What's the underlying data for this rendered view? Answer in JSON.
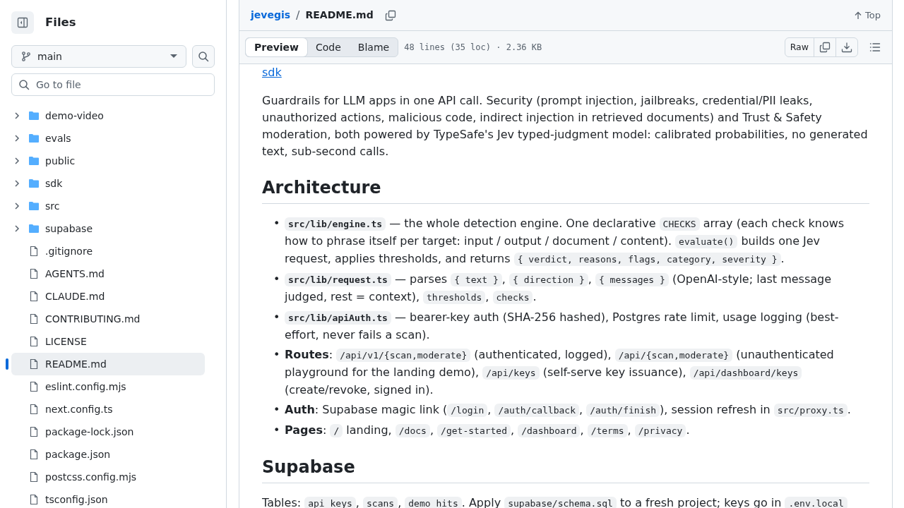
{
  "sidebar": {
    "title": "Files",
    "branch": "main",
    "search": {
      "placeholder": "Go to file"
    },
    "tree": [
      {
        "name": "demo-video",
        "kind": "folder",
        "expanded": false,
        "selected": false
      },
      {
        "name": "evals",
        "kind": "folder",
        "expanded": false,
        "selected": false
      },
      {
        "name": "public",
        "kind": "folder",
        "expanded": false,
        "selected": false
      },
      {
        "name": "sdk",
        "kind": "folder",
        "expanded": false,
        "selected": false
      },
      {
        "name": "src",
        "kind": "folder",
        "expanded": false,
        "selected": false
      },
      {
        "name": "supabase",
        "kind": "folder",
        "expanded": false,
        "selected": false
      },
      {
        "name": ".gitignore",
        "kind": "file",
        "selected": false
      },
      {
        "name": "AGENTS.md",
        "kind": "file",
        "selected": false
      },
      {
        "name": "CLAUDE.md",
        "kind": "file",
        "selected": false
      },
      {
        "name": "CONTRIBUTING.md",
        "kind": "file",
        "selected": false
      },
      {
        "name": "LICENSE",
        "kind": "file",
        "selected": false
      },
      {
        "name": "README.md",
        "kind": "file",
        "selected": true
      },
      {
        "name": "eslint.config.mjs",
        "kind": "file",
        "selected": false
      },
      {
        "name": "next.config.ts",
        "kind": "file",
        "selected": false
      },
      {
        "name": "package-lock.json",
        "kind": "file",
        "selected": false
      },
      {
        "name": "package.json",
        "kind": "file",
        "selected": false
      },
      {
        "name": "postcss.config.mjs",
        "kind": "file",
        "selected": false
      },
      {
        "name": "tsconfig.json",
        "kind": "file",
        "selected": false
      }
    ]
  },
  "breadcrumb": {
    "repo": "jevegis",
    "separator": "/",
    "file": "README.md"
  },
  "top_link": "Top",
  "tabs": [
    {
      "label": "Preview",
      "selected": true
    },
    {
      "label": "Code",
      "selected": false
    },
    {
      "label": "Blame",
      "selected": false
    }
  ],
  "file_info": "48 lines (35 loc) · 2.36 KB",
  "raw_button": "Raw",
  "content": [
    {
      "kind": "link",
      "text": "sdk"
    },
    {
      "kind": "paragraph",
      "parts": [
        {
          "kind": "text",
          "text": "Guardrails for LLM apps in one API call. Security (prompt injection, jailbreaks, credential/PII leaks, unauthorized actions, malicious code, indirect injection in retrieved documents) and Trust & Safety moderation, both powered by TypeSafe's Jev typed-judgment model: calibrated probabilities, no generated text, sub-second calls."
        }
      ]
    },
    {
      "kind": "heading",
      "text": "Architecture"
    },
    {
      "kind": "list",
      "marker": "•",
      "items": [
        [
          {
            "kind": "bold_code",
            "text": "src/lib/engine.ts"
          },
          {
            "kind": "text",
            "text": " — the whole detection engine. One declarative "
          },
          {
            "kind": "code",
            "text": "CHECKS"
          },
          {
            "kind": "text",
            "text": " array (each check knows how to phrase itself per target: input / output / document / content). "
          },
          {
            "kind": "code",
            "text": "evaluate()"
          },
          {
            "kind": "text",
            "text": " builds one Jev request, applies thresholds, and returns "
          },
          {
            "kind": "code",
            "text": "{ verdict, reasons, flags, category, severity }"
          },
          {
            "kind": "text",
            "text": "."
          }
        ],
        [
          {
            "kind": "bold_code",
            "text": "src/lib/request.ts"
          },
          {
            "kind": "text",
            "text": " — parses "
          },
          {
            "kind": "code",
            "text": "{ text }"
          },
          {
            "kind": "text",
            "text": ", "
          },
          {
            "kind": "code",
            "text": "{ direction }"
          },
          {
            "kind": "text",
            "text": ", "
          },
          {
            "kind": "code",
            "text": "{ messages }"
          },
          {
            "kind": "text",
            "text": " (OpenAI-style; last message judged, rest = context), "
          },
          {
            "kind": "code",
            "text": "thresholds"
          },
          {
            "kind": "text",
            "text": ", "
          },
          {
            "kind": "code",
            "text": "checks"
          },
          {
            "kind": "text",
            "text": "."
          }
        ],
        [
          {
            "kind": "bold_code",
            "text": "src/lib/apiAuth.ts"
          },
          {
            "kind": "text",
            "text": " — bearer-key auth (SHA-256 hashed), Postgres rate limit, usage logging (best-effort, never fails a scan)."
          }
        ],
        [
          {
            "kind": "bold",
            "text": "Routes"
          },
          {
            "kind": "text",
            "text": ": "
          },
          {
            "kind": "code",
            "text": "/api/v1/{scan,moderate}"
          },
          {
            "kind": "text",
            "text": " (authenticated, logged), "
          },
          {
            "kind": "code",
            "text": "/api/{scan,moderate}"
          },
          {
            "kind": "text",
            "text": " (unauthenticated playground for the landing demo), "
          },
          {
            "kind": "code",
            "text": "/api/keys"
          },
          {
            "kind": "text",
            "text": " (self-serve key issuance), "
          },
          {
            "kind": "code",
            "text": "/api/dashboard/keys"
          },
          {
            "kind": "text",
            "text": " (create/revoke, signed in)."
          }
        ],
        [
          {
            "kind": "bold",
            "text": "Auth"
          },
          {
            "kind": "text",
            "text": ": Supabase magic link ("
          },
          {
            "kind": "code",
            "text": "/login"
          },
          {
            "kind": "text",
            "text": ", "
          },
          {
            "kind": "code",
            "text": "/auth/callback"
          },
          {
            "kind": "text",
            "text": ", "
          },
          {
            "kind": "code",
            "text": "/auth/finish"
          },
          {
            "kind": "text",
            "text": "), session refresh in "
          },
          {
            "kind": "code",
            "text": "src/proxy.ts"
          },
          {
            "kind": "text",
            "text": "."
          }
        ],
        [
          {
            "kind": "bold",
            "text": "Pages"
          },
          {
            "kind": "text",
            "text": ": "
          },
          {
            "kind": "code",
            "text": "/"
          },
          {
            "kind": "text",
            "text": " landing, "
          },
          {
            "kind": "code",
            "text": "/docs"
          },
          {
            "kind": "text",
            "text": ", "
          },
          {
            "kind": "code",
            "text": "/get-started"
          },
          {
            "kind": "text",
            "text": ", "
          },
          {
            "kind": "code",
            "text": "/dashboard"
          },
          {
            "kind": "text",
            "text": ", "
          },
          {
            "kind": "code",
            "text": "/terms"
          },
          {
            "kind": "text",
            "text": ", "
          },
          {
            "kind": "code",
            "text": "/privacy"
          },
          {
            "kind": "text",
            "text": "."
          }
        ]
      ]
    },
    {
      "kind": "heading",
      "text": "Supabase"
    },
    {
      "kind": "paragraph",
      "parts": [
        {
          "kind": "text",
          "text": "Tables: "
        },
        {
          "kind": "code",
          "text": "api_keys"
        },
        {
          "kind": "text",
          "text": ", "
        },
        {
          "kind": "code",
          "text": "scans"
        },
        {
          "kind": "text",
          "text": ", "
        },
        {
          "kind": "code",
          "text": "demo_hits"
        },
        {
          "kind": "text",
          "text": ". Apply "
        },
        {
          "kind": "code",
          "text": "supabase/schema.sql"
        },
        {
          "kind": "text",
          "text": " to a fresh project; keys go in "
        },
        {
          "kind": "code",
          "text": ".env.local"
        }
      ]
    }
  ]
}
